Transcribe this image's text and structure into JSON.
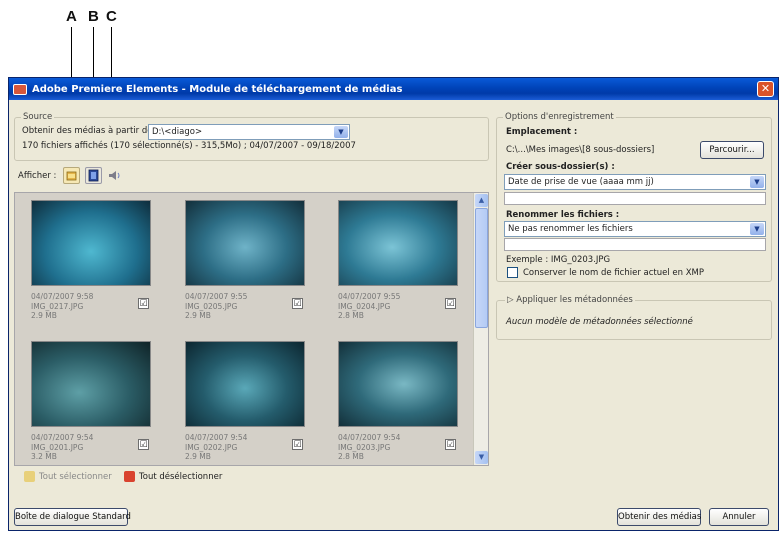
{
  "callouts": [
    "A",
    "B",
    "C"
  ],
  "window": {
    "title": "Adobe Premiere Elements - Module de téléchargement de médias",
    "close": "✕"
  },
  "source": {
    "group_title": "Source",
    "obtain_label": "Obtenir des médias à partir de :",
    "obtain_value": "D:\\<diago>",
    "summary": "170 fichiers affichés (170 sélectionné(s) - 315,5Mo) ; 04/07/2007 - 09/18/2007"
  },
  "show": {
    "label": "Afficher :",
    "filters": [
      "image-filter-icon",
      "video-filter-icon",
      "audio-filter-icon"
    ]
  },
  "thumbnails": [
    {
      "date": "04/07/2007 9:58",
      "file": "IMG_0217.JPG",
      "size": "2.9 MB",
      "checked": true
    },
    {
      "date": "04/07/2007 9:55",
      "file": "IMG_0205.JPG",
      "size": "2.9 MB",
      "checked": true
    },
    {
      "date": "04/07/2007 9:55",
      "file": "IMG_0204.JPG",
      "size": "2.8 MB",
      "checked": true
    },
    {
      "date": "04/07/2007 9:54",
      "file": "IMG_0201.JPG",
      "size": "3.2 MB",
      "checked": true
    },
    {
      "date": "04/07/2007 9:54",
      "file": "IMG_0202.JPG",
      "size": "2.9 MB",
      "checked": true
    },
    {
      "date": "04/07/2007 9:54",
      "file": "IMG_0203.JPG",
      "size": "2.8 MB",
      "checked": true
    }
  ],
  "check_mark": "☑",
  "selection": {
    "select_all": "Tout sélectionner",
    "deselect_all": "Tout désélectionner"
  },
  "save_options": {
    "group_title": "Options d'enregistrement",
    "location_label": "Emplacement :",
    "location_value": "C:\\...\\Mes images\\[8 sous-dossiers]",
    "browse_button": "Parcourir...",
    "subfolder_label": "Créer sous-dossier(s) :",
    "subfolder_value": "Date de prise de vue (aaaa mm jj)",
    "rename_label": "Renommer les fichiers :",
    "rename_value": "Ne pas renommer les fichiers",
    "example": "Exemple : IMG_0203.JPG",
    "keep_filename": "Conserver le nom de fichier actuel en XMP"
  },
  "metadata": {
    "title": "Appliquer les métadonnées",
    "expander": "▷",
    "status": "Aucun modèle de métadonnées sélectionné"
  },
  "footer": {
    "standard_button": "Boîte de dialogue Standard",
    "get_media_button": "Obtenir des médias",
    "cancel_button": "Annuler"
  }
}
